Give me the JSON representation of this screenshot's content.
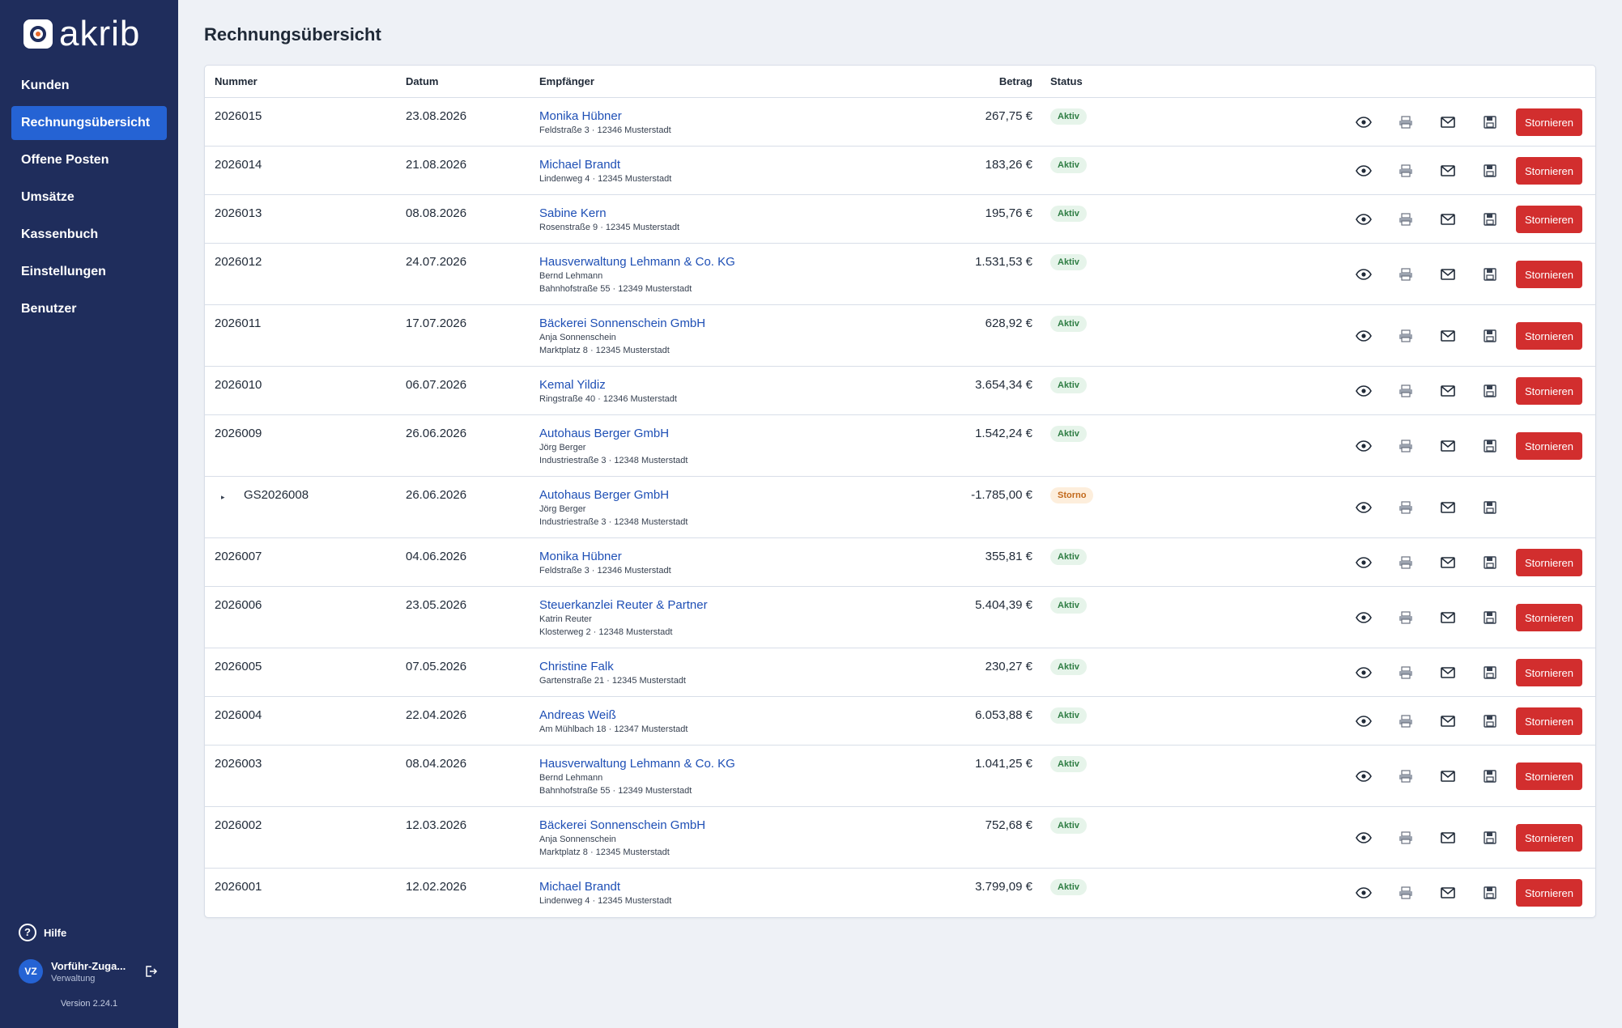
{
  "app": {
    "logo_text": "akrib",
    "version": "Version 2.24.1"
  },
  "sidebar": {
    "items": [
      {
        "label": "Kunden",
        "active": false
      },
      {
        "label": "Rechnungsübersicht",
        "active": true
      },
      {
        "label": "Offene Posten",
        "active": false
      },
      {
        "label": "Umsätze",
        "active": false
      },
      {
        "label": "Kassenbuch",
        "active": false
      },
      {
        "label": "Einstellungen",
        "active": false
      },
      {
        "label": "Benutzer",
        "active": false
      }
    ],
    "help_label": "Hilfe",
    "user": {
      "initials": "VZ",
      "name": "Vorführ-Zuga...",
      "role": "Verwaltung"
    }
  },
  "page": {
    "title": "Rechnungsübersicht"
  },
  "table": {
    "headers": {
      "number": "Nummer",
      "date": "Datum",
      "recipient": "Empfänger",
      "amount": "Betrag",
      "status": "Status"
    },
    "cancel_label": "Stornieren",
    "rows": [
      {
        "number": "2026015",
        "date": "23.08.2026",
        "name": "Monika Hübner",
        "lines": [
          "Feldstraße 3 · 12346 Musterstadt"
        ],
        "amount": "267,75 €",
        "status": "Aktiv",
        "cancellable": true
      },
      {
        "number": "2026014",
        "date": "21.08.2026",
        "name": "Michael Brandt",
        "lines": [
          "Lindenweg 4 · 12345 Musterstadt"
        ],
        "amount": "183,26 €",
        "status": "Aktiv",
        "cancellable": true
      },
      {
        "number": "2026013",
        "date": "08.08.2026",
        "name": "Sabine Kern",
        "lines": [
          "Rosenstraße 9 · 12345 Musterstadt"
        ],
        "amount": "195,76 €",
        "status": "Aktiv",
        "cancellable": true
      },
      {
        "number": "2026012",
        "date": "24.07.2026",
        "name": "Hausverwaltung Lehmann & Co. KG",
        "lines": [
          "Bernd Lehmann",
          "Bahnhofstraße 55 · 12349 Musterstadt"
        ],
        "amount": "1.531,53 €",
        "status": "Aktiv",
        "cancellable": true
      },
      {
        "number": "2026011",
        "date": "17.07.2026",
        "name": "Bäckerei Sonnenschein GmbH",
        "lines": [
          "Anja Sonnenschein",
          "Marktplatz 8 · 12345 Musterstadt"
        ],
        "amount": "628,92 €",
        "status": "Aktiv",
        "cancellable": true
      },
      {
        "number": "2026010",
        "date": "06.07.2026",
        "name": "Kemal Yildiz",
        "lines": [
          "Ringstraße 40 · 12346 Musterstadt"
        ],
        "amount": "3.654,34 €",
        "status": "Aktiv",
        "cancellable": true
      },
      {
        "number": "2026009",
        "date": "26.06.2026",
        "name": "Autohaus Berger GmbH",
        "lines": [
          "Jörg Berger",
          "Industriestraße 3 · 12348 Musterstadt"
        ],
        "amount": "1.542,24 €",
        "status": "Aktiv",
        "cancellable": true
      },
      {
        "number": "GS2026008",
        "date": "26.06.2026",
        "name": "Autohaus Berger GmbH",
        "lines": [
          "Jörg Berger",
          "Industriestraße 3 · 12348 Musterstadt"
        ],
        "amount": "-1.785,00 €",
        "status": "Storno",
        "cancellable": false,
        "expander": "▸"
      },
      {
        "number": "2026007",
        "date": "04.06.2026",
        "name": "Monika Hübner",
        "lines": [
          "Feldstraße 3 · 12346 Musterstadt"
        ],
        "amount": "355,81 €",
        "status": "Aktiv",
        "cancellable": true
      },
      {
        "number": "2026006",
        "date": "23.05.2026",
        "name": "Steuerkanzlei Reuter & Partner",
        "lines": [
          "Katrin Reuter",
          "Klosterweg 2 · 12348 Musterstadt"
        ],
        "amount": "5.404,39 €",
        "status": "Aktiv",
        "cancellable": true
      },
      {
        "number": "2026005",
        "date": "07.05.2026",
        "name": "Christine Falk",
        "lines": [
          "Gartenstraße 21 · 12345 Musterstadt"
        ],
        "amount": "230,27 €",
        "status": "Aktiv",
        "cancellable": true
      },
      {
        "number": "2026004",
        "date": "22.04.2026",
        "name": "Andreas Weiß",
        "lines": [
          "Am Mühlbach 18 · 12347 Musterstadt"
        ],
        "amount": "6.053,88 €",
        "status": "Aktiv",
        "cancellable": true
      },
      {
        "number": "2026003",
        "date": "08.04.2026",
        "name": "Hausverwaltung Lehmann & Co. KG",
        "lines": [
          "Bernd Lehmann",
          "Bahnhofstraße 55 · 12349 Musterstadt"
        ],
        "amount": "1.041,25 €",
        "status": "Aktiv",
        "cancellable": true
      },
      {
        "number": "2026002",
        "date": "12.03.2026",
        "name": "Bäckerei Sonnenschein GmbH",
        "lines": [
          "Anja Sonnenschein",
          "Marktplatz 8 · 12345 Musterstadt"
        ],
        "amount": "752,68 €",
        "status": "Aktiv",
        "cancellable": true
      },
      {
        "number": "2026001",
        "date": "12.02.2026",
        "name": "Michael Brandt",
        "lines": [
          "Lindenweg 4 · 12345 Musterstadt"
        ],
        "amount": "3.799,09 €",
        "status": "Aktiv",
        "cancellable": true
      }
    ]
  },
  "colors": {
    "sidebar_bg": "#1f2d5c",
    "accent": "#2563d4",
    "link": "#1e4fb5",
    "danger": "#d22e2e",
    "badge_aktiv": "#2e7d43",
    "badge_storno": "#c2691b"
  },
  "icons": [
    "eye-icon",
    "print-icon",
    "mail-icon",
    "save-icon",
    "help-icon",
    "logout-icon"
  ]
}
